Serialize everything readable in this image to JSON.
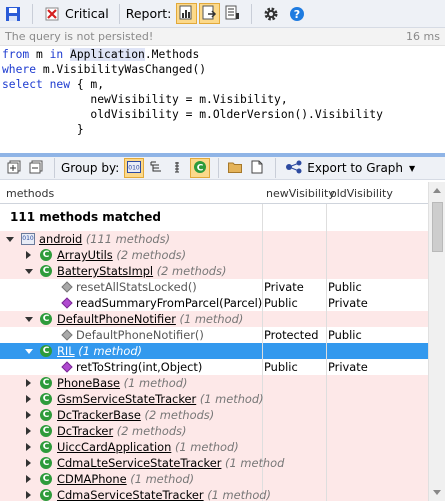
{
  "toolbar": {
    "critical_label": "Critical",
    "report_label": "Report:"
  },
  "status": {
    "message": "The query is not persisted!",
    "time": "16 ms"
  },
  "query": {
    "lines": [
      "from m in Application.Methods",
      "where m.VisibilityWasChanged()",
      "select new { m,",
      "             newVisibility = m.Visibility,",
      "             oldVisibility = m.OlderVersion().Visibility",
      "           }"
    ]
  },
  "query_toolbar": {
    "group_by_label": "Group by:",
    "export_label": "Export to Graph"
  },
  "grid": {
    "headers": {
      "methods": "methods",
      "new_visibility": "newVisibility",
      "old_visibility": "oldVisibility"
    },
    "matched": "111 methods matched",
    "rows": [
      {
        "name": "android",
        "count": "(111 methods)",
        "new": "",
        "old": ""
      },
      {
        "name": "ArrayUtils",
        "count": "(2 methods)",
        "new": "",
        "old": ""
      },
      {
        "name": "BatteryStatsImpl",
        "count": "(2 methods)",
        "new": "",
        "old": ""
      },
      {
        "name": "resetAllStatsLocked()",
        "count": "",
        "new": "Private",
        "old": "Public"
      },
      {
        "name": "readSummaryFromParcel(Parcel)",
        "count": "",
        "new": "Public",
        "old": "Private"
      },
      {
        "name": "DefaultPhoneNotifier",
        "count": "(1 method)",
        "new": "",
        "old": ""
      },
      {
        "name": "DefaultPhoneNotifier()",
        "count": "",
        "new": "Protected",
        "old": "Public"
      },
      {
        "name": "RIL",
        "count": "(1 method)",
        "new": "",
        "old": ""
      },
      {
        "name": "retToString(int,Object)",
        "count": "",
        "new": "Public",
        "old": "Private"
      },
      {
        "name": "PhoneBase",
        "count": "(1 method)",
        "new": "",
        "old": ""
      },
      {
        "name": "GsmServiceStateTracker",
        "count": "(1 method)",
        "new": "",
        "old": ""
      },
      {
        "name": "DcTrackerBase",
        "count": "(2 methods)",
        "new": "",
        "old": ""
      },
      {
        "name": "DcTracker",
        "count": "(2 methods)",
        "new": "",
        "old": ""
      },
      {
        "name": "UiccCardApplication",
        "count": "(1 method)",
        "new": "",
        "old": ""
      },
      {
        "name": "CdmaLteServiceStateTracker",
        "count": "(1 method",
        "new": "",
        "old": ""
      },
      {
        "name": "CDMAPhone",
        "count": "(1 method)",
        "new": "",
        "old": ""
      },
      {
        "name": "CdmaServiceStateTracker",
        "count": "(1 method)",
        "new": "",
        "old": ""
      }
    ]
  },
  "colors": {
    "selection": "#3399ee",
    "pink_row": "#fde8e8",
    "keyword": "#1d3bd0",
    "class_icon": "#2e9b3b"
  }
}
